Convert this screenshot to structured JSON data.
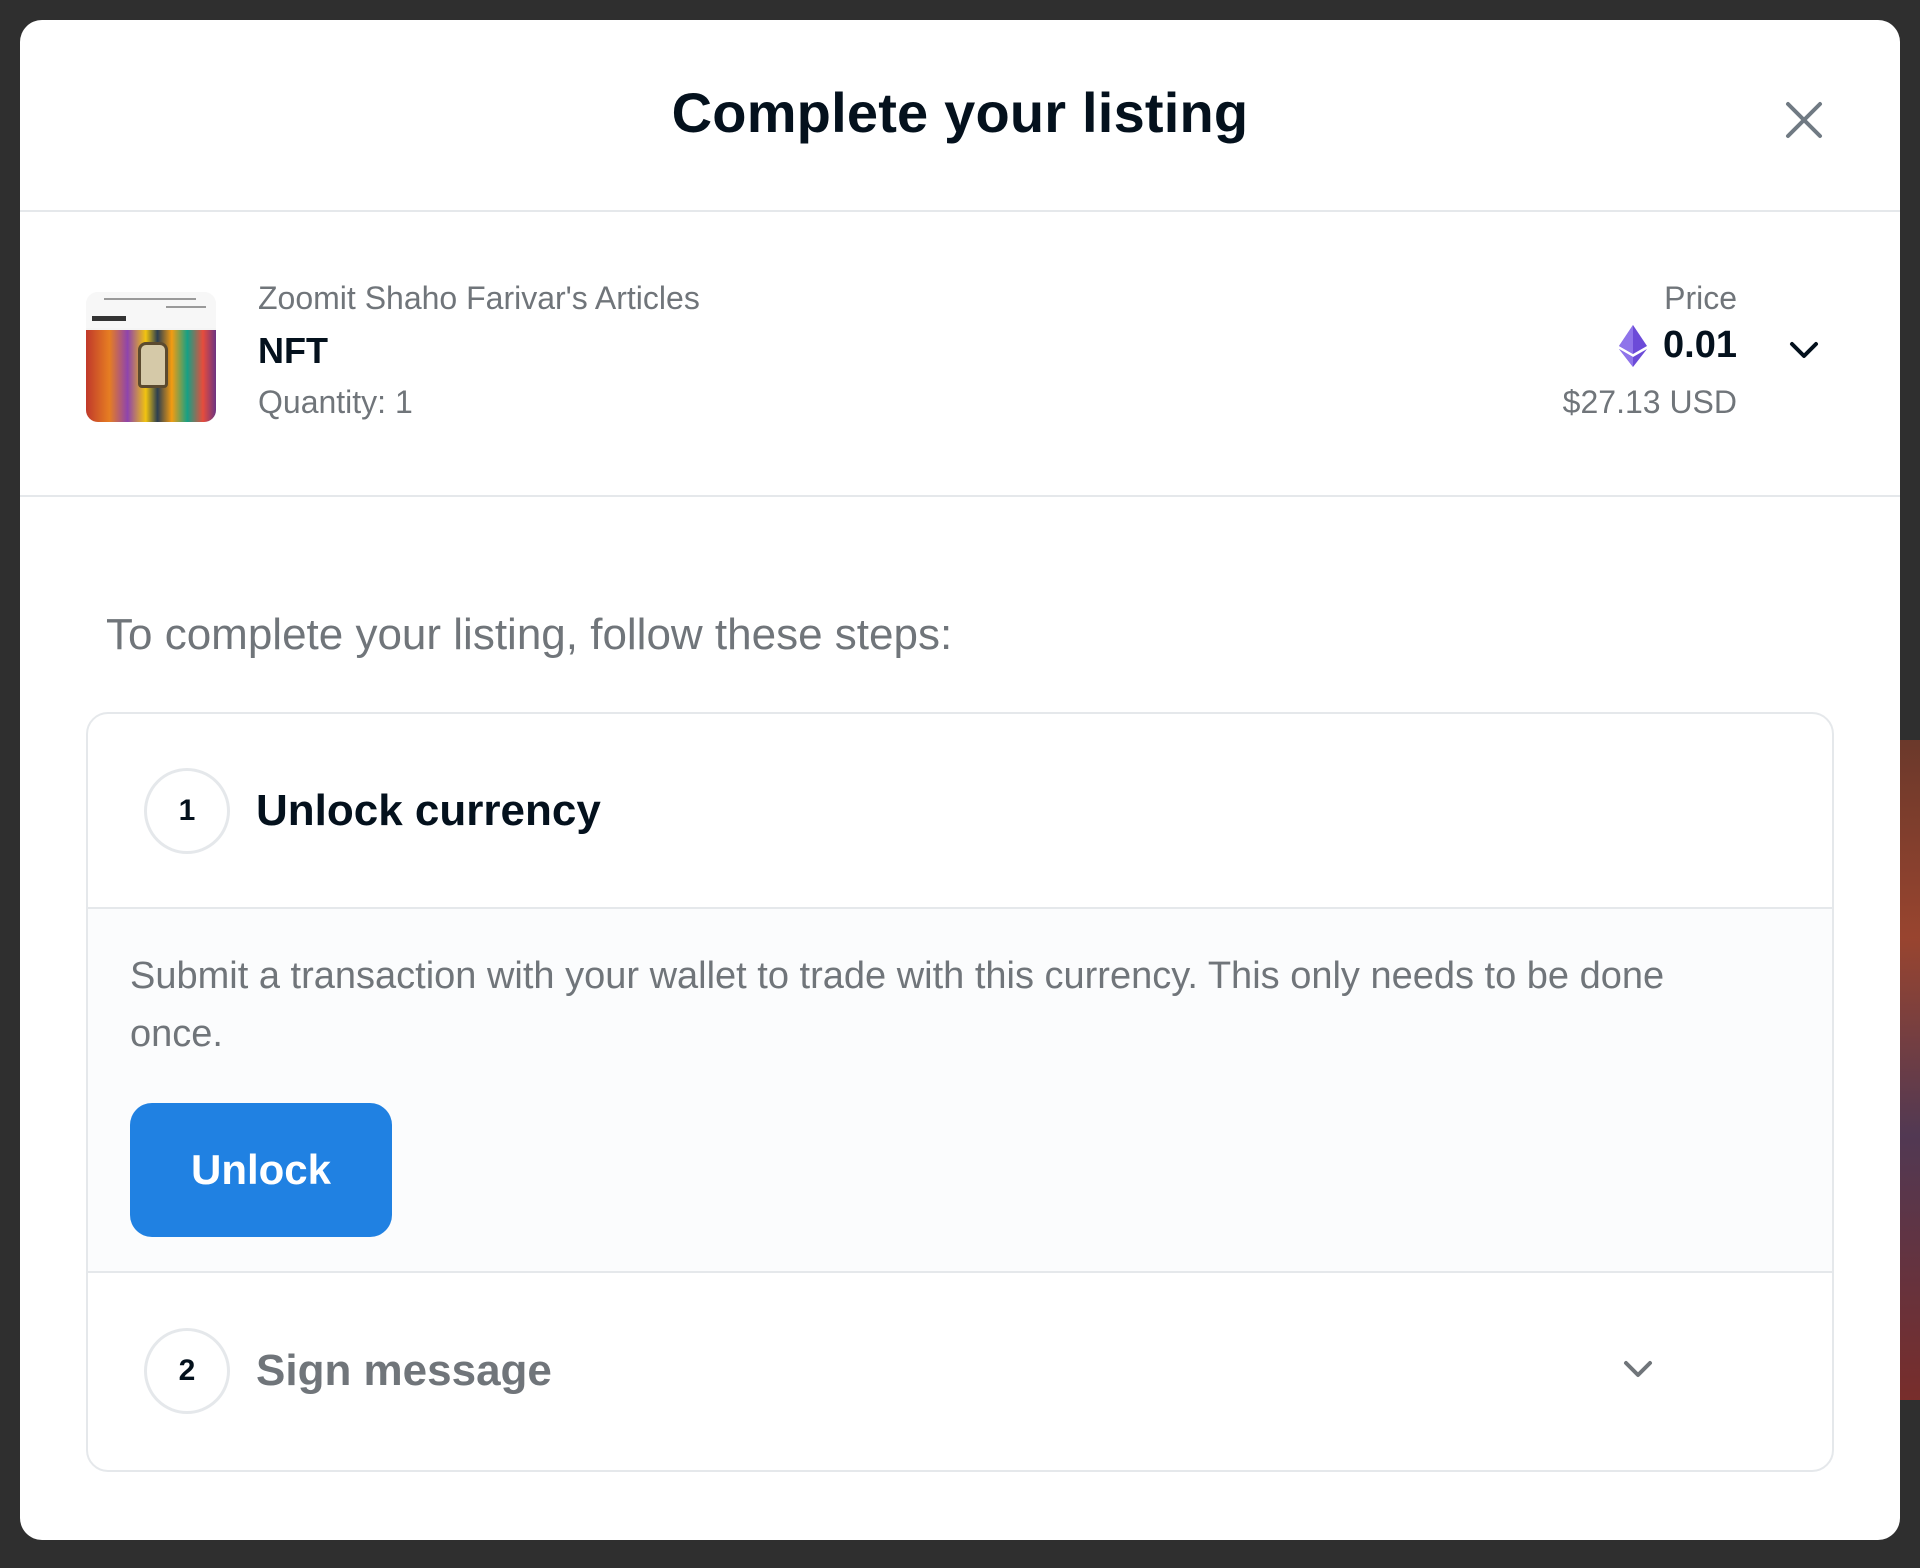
{
  "modal": {
    "title": "Complete your listing"
  },
  "item": {
    "collection": "Zoomit Shaho Farivar's Articles",
    "name": "NFT",
    "quantity": "Quantity: 1",
    "thumbnail_icon": "nft-thumbnail"
  },
  "price": {
    "label": "Price",
    "eth": "0.01",
    "usd": "$27.13 USD",
    "currency_icon": "ethereum-icon"
  },
  "instructions": "To complete your listing, follow these steps:",
  "steps": [
    {
      "number": "1",
      "title": "Unlock currency",
      "description": "Submit a transaction with your wallet to trade with this currency. This only needs to be done once.",
      "button_label": "Unlock"
    },
    {
      "number": "2",
      "title": "Sign message"
    }
  ],
  "colors": {
    "primary_button": "#2081e2",
    "text_primary": "#04111d",
    "text_secondary": "#70757a",
    "eth_icon": "#6c4bd8",
    "border": "#e5e8eb"
  }
}
